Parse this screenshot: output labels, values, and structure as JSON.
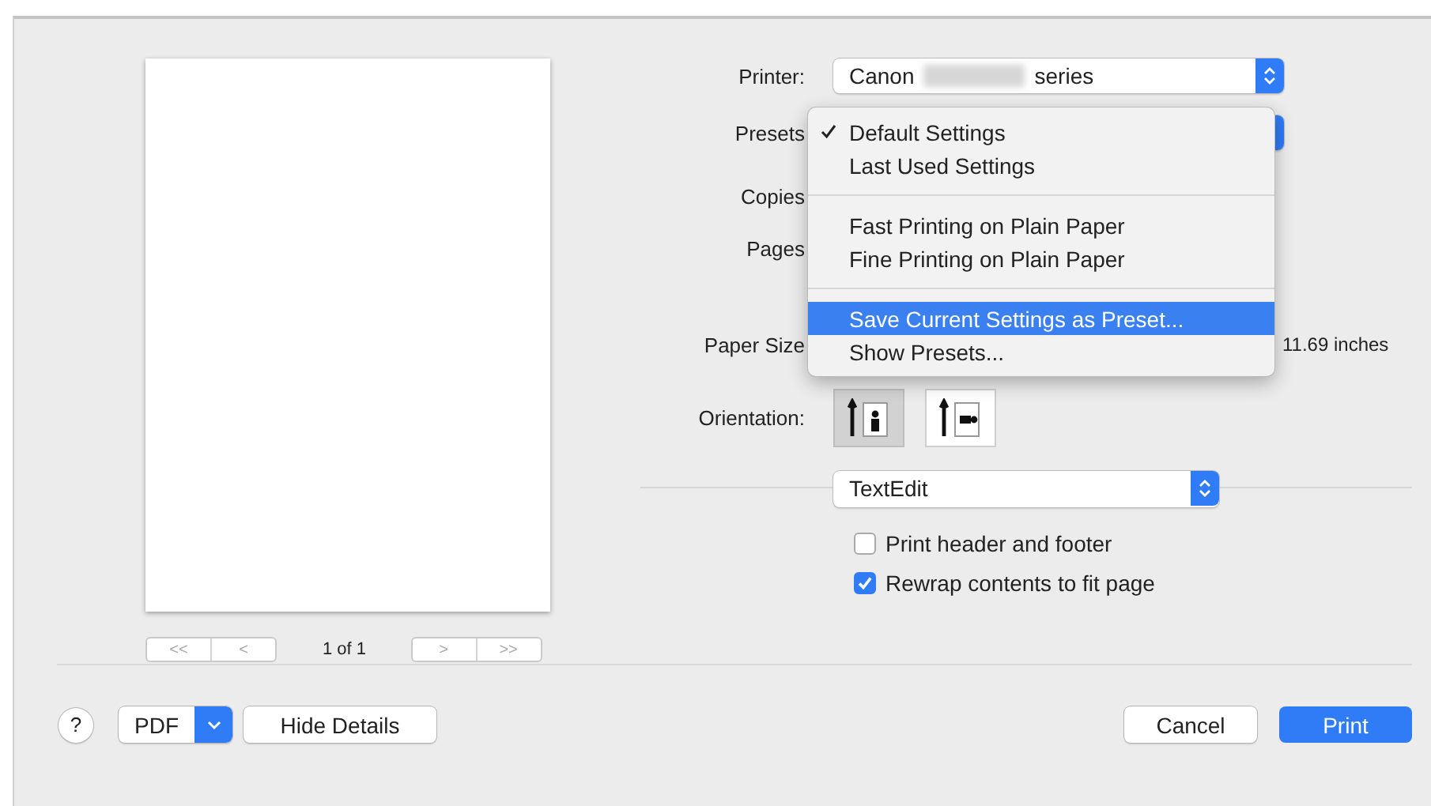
{
  "printer": {
    "label": "Printer:",
    "value_start": "Canon",
    "value_end": "series"
  },
  "presets": {
    "label": "Presets"
  },
  "copies": {
    "label": "Copies"
  },
  "pages": {
    "label": "Pages"
  },
  "paper_size": {
    "label": "Paper Size",
    "dimensions": "11.69 inches"
  },
  "orientation": {
    "label": "Orientation:",
    "options": [
      {
        "kind": "portrait",
        "selected": true
      },
      {
        "kind": "landscape",
        "selected": false
      }
    ]
  },
  "presets_menu": {
    "groups": [
      [
        {
          "label": "Default Settings",
          "checked": true,
          "selected": false
        },
        {
          "label": "Last Used Settings",
          "checked": false,
          "selected": false
        }
      ],
      [
        {
          "label": "Fast Printing on Plain Paper",
          "checked": false,
          "selected": false
        },
        {
          "label": "Fine Printing on Plain Paper",
          "checked": false,
          "selected": false
        }
      ],
      [
        {
          "label": "Save Current Settings as Preset...",
          "checked": false,
          "selected": true
        },
        {
          "label": "Show Presets...",
          "checked": false,
          "selected": false
        }
      ]
    ]
  },
  "app_popup": {
    "value": "TextEdit"
  },
  "options": [
    {
      "label": "Print header and footer",
      "checked": false
    },
    {
      "label": "Rewrap contents to fit page",
      "checked": true
    }
  ],
  "preview_nav": {
    "first": "<<",
    "previous": "<",
    "page": "1 of 1",
    "next": ">",
    "last": ">>"
  },
  "footer": {
    "help": "?",
    "pdf": "PDF",
    "hide_details": "Hide Details",
    "cancel": "Cancel",
    "print": "Print"
  }
}
